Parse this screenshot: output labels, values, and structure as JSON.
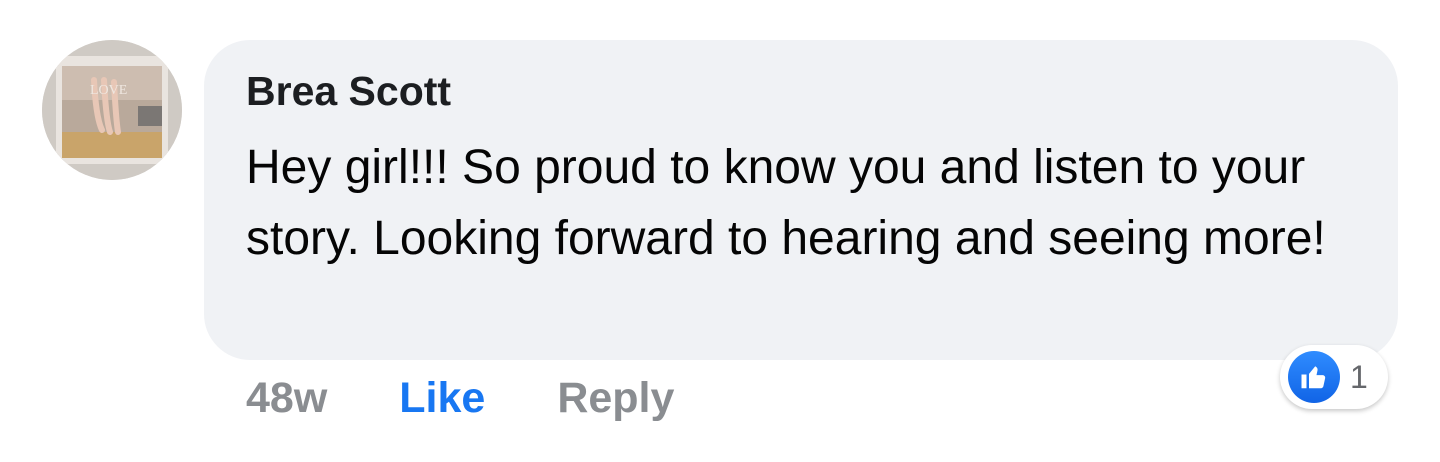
{
  "comment": {
    "author": "Brea Scott",
    "text": "Hey girl!!! So proud to know you and listen to your story. Looking forward to hearing and seeing more!",
    "timestamp": "48w",
    "like_label": "Like",
    "reply_label": "Reply",
    "reactions": {
      "icon": "thumbs-up-icon",
      "count": "1"
    },
    "avatar_caption": "LOVE"
  },
  "colors": {
    "bubble_bg": "#f0f2f5",
    "like_blue": "#1877f2",
    "muted_gray": "#8a8d91"
  }
}
